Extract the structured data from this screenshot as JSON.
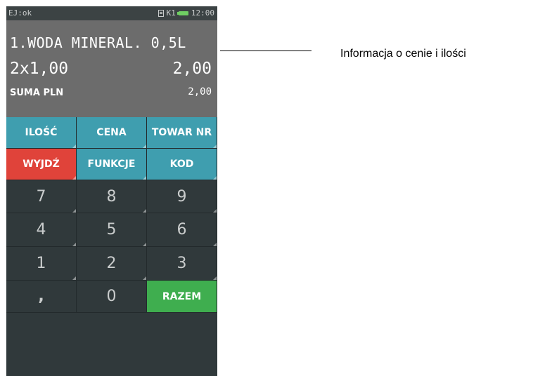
{
  "status": {
    "left": "EJ:ok",
    "drawer": "K1",
    "time": "12:00"
  },
  "display": {
    "item_line": "1.WODA MINERAL. 0,5L",
    "qty_price": "2x1,00",
    "amount": "2,00",
    "sum_label": "SUMA PLN",
    "sum_value": "2,00"
  },
  "keys": {
    "ilosc": "ILOŚĆ",
    "cena": "CENA",
    "towar_nr": "TOWAR NR",
    "wyjdz": "WYJDŹ",
    "funkcje": "FUNKCJE",
    "kod": "KOD",
    "k7": "7",
    "k8": "8",
    "k9": "9",
    "k4": "4",
    "k5": "5",
    "k6": "6",
    "k1": "1",
    "k2": "2",
    "k3": "3",
    "comma": ",",
    "k0": "0",
    "razem": "RAZEM"
  },
  "annotation": "Informacja o cenie i ilości",
  "colors": {
    "function_key": "#3f9eaf",
    "exit_key": "#e0433a",
    "total_key": "#3fae4f",
    "display": "#6c6c6c",
    "keypad": "#30393b"
  }
}
